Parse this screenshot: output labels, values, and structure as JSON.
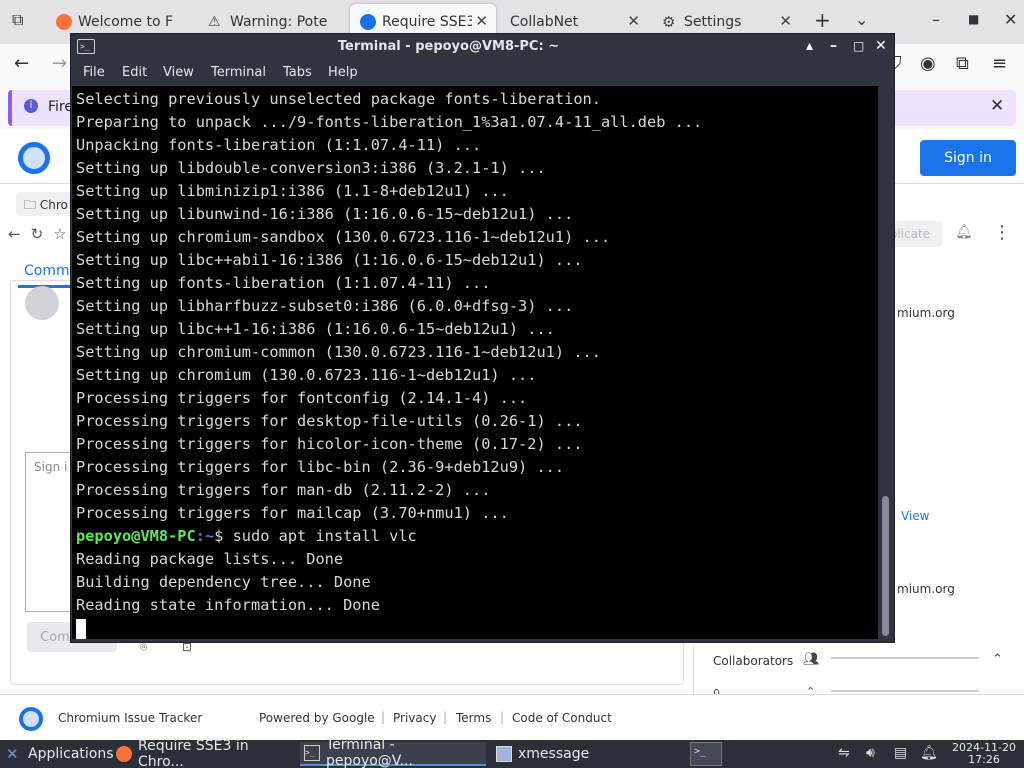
{
  "firefox": {
    "tabs": [
      {
        "label": "Welcome to F",
        "fav_color": "#ff7139"
      },
      {
        "label": "Warning: Pote",
        "fav_color": "#444444"
      },
      {
        "label": "Require SSE3",
        "fav_color": "#1a73e8",
        "active": true
      },
      {
        "label": "CollabNet",
        "fav_color": ""
      },
      {
        "label": "Settings",
        "fav_color": ""
      }
    ],
    "notification_text": "Fire"
  },
  "page": {
    "sign_in_label": "Sign in",
    "crumb_label": "Chro",
    "tab_comments": "Comm",
    "comment_placeholder": "Sign i",
    "comment_button": "Comment",
    "duplicate_label": "olicate",
    "cc_email1": "mium.org",
    "view_link": "View",
    "cc_email2": "mium.org",
    "collaborators_label": "Collaborators",
    "collab_count": "0 ."
  },
  "footer": {
    "title": "Chromium Issue Tracker",
    "powered": "Powered by Google",
    "privacy": "Privacy",
    "terms": "Terms",
    "conduct": "Code of Conduct"
  },
  "terminal": {
    "title": "Terminal - pepoyo@VM8-PC: ~",
    "menu": [
      "File",
      "Edit",
      "View",
      "Terminal",
      "Tabs",
      "Help"
    ],
    "output_before": [
      "Selecting previously unselected package fonts-liberation.",
      "Preparing to unpack .../9-fonts-liberation_1%3a1.07.4-11_all.deb ...",
      "Unpacking fonts-liberation (1:1.07.4-11) ...",
      "Setting up libdouble-conversion3:i386 (3.2.1-1) ...",
      "Setting up libminizip1:i386 (1.1-8+deb12u1) ...",
      "Setting up libunwind-16:i386 (1:16.0.6-15~deb12u1) ...",
      "Setting up chromium-sandbox (130.0.6723.116-1~deb12u1) ...",
      "Setting up libc++abi1-16:i386 (1:16.0.6-15~deb12u1) ...",
      "Setting up fonts-liberation (1:1.07.4-11) ...",
      "Setting up libharfbuzz-subset0:i386 (6.0.0+dfsg-3) ...",
      "Setting up libc++1-16:i386 (1:16.0.6-15~deb12u1) ...",
      "Setting up chromium-common (130.0.6723.116-1~deb12u1) ...",
      "Setting up chromium (130.0.6723.116-1~deb12u1) ...",
      "Processing triggers for fontconfig (2.14.1-4) ...",
      "Processing triggers for desktop-file-utils (0.26-1) ...",
      "Processing triggers for hicolor-icon-theme (0.17-2) ...",
      "Processing triggers for libc-bin (2.36-9+deb12u9) ...",
      "Processing triggers for man-db (2.11.2-2) ...",
      "Processing triggers for mailcap (3.70+nmu1) ..."
    ],
    "prompt_user": "pepoyo@VM8-PC",
    "prompt_path": ":~",
    "prompt_symbol": "$ ",
    "command": "sudo apt install vlc",
    "output_after": [
      "Reading package lists... Done",
      "Building dependency tree... Done",
      "Reading state information... Done"
    ]
  },
  "taskbar": {
    "applications": "Applications",
    "windows": [
      {
        "label": "Require SSE3 in Chro..."
      },
      {
        "label": "Terminal - pepoyo@V..."
      },
      {
        "label": "xmessage"
      }
    ],
    "date": "2024-11-20",
    "time": "17:26"
  },
  "colors": {
    "prompt_user": "#5ee85a",
    "prompt_path": "#4b7bd8",
    "accent": "#1a73e8"
  }
}
